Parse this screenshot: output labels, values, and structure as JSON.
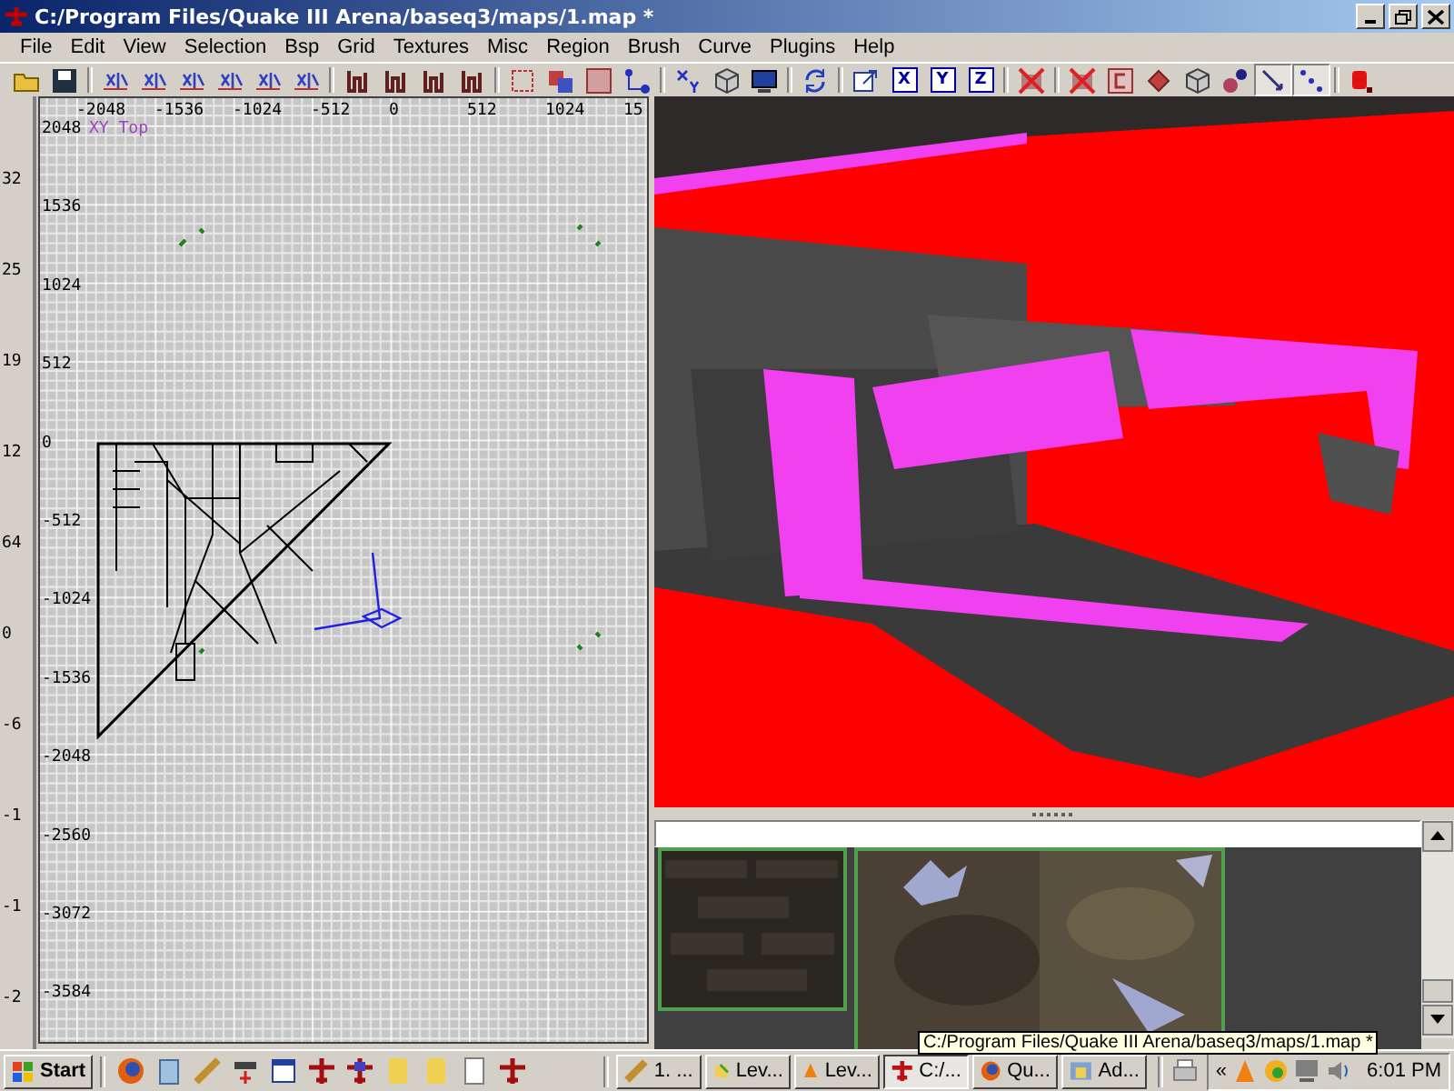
{
  "window": {
    "title": "C:/Program Files/Quake III Arena/baseq3/maps/1.map *"
  },
  "menu": [
    "File",
    "Edit",
    "View",
    "Selection",
    "Bsp",
    "Grid",
    "Textures",
    "Misc",
    "Region",
    "Brush",
    "Curve",
    "Plugins",
    "Help"
  ],
  "toolbar": [
    {
      "kind": "button",
      "selected": false
    },
    {
      "kind": "button",
      "selected": false
    },
    {
      "kind": "separator"
    },
    {
      "kind": "button",
      "selected": false
    },
    {
      "kind": "button",
      "selected": false
    },
    {
      "kind": "button",
      "selected": false
    },
    {
      "kind": "button",
      "selected": false
    },
    {
      "kind": "button",
      "selected": false
    },
    {
      "kind": "button",
      "selected": false
    },
    {
      "kind": "separator"
    },
    {
      "kind": "button",
      "selected": false
    },
    {
      "kind": "button",
      "selected": false
    },
    {
      "kind": "button",
      "selected": false
    },
    {
      "kind": "button",
      "selected": false
    },
    {
      "kind": "separator"
    },
    {
      "kind": "button",
      "selected": false
    },
    {
      "kind": "button",
      "selected": false
    },
    {
      "kind": "button",
      "selected": false
    },
    {
      "kind": "button",
      "selected": false
    },
    {
      "kind": "separator"
    },
    {
      "kind": "button",
      "selected": false
    },
    {
      "kind": "button",
      "selected": false
    },
    {
      "kind": "button",
      "selected": false
    },
    {
      "kind": "separator"
    },
    {
      "kind": "button",
      "selected": false
    },
    {
      "kind": "separator"
    },
    {
      "kind": "button",
      "selected": false
    },
    {
      "kind": "button",
      "selected": false,
      "label": "X"
    },
    {
      "kind": "button",
      "selected": false,
      "label": "Y"
    },
    {
      "kind": "button",
      "selected": false,
      "label": "Z"
    },
    {
      "kind": "separator"
    },
    {
      "kind": "button",
      "selected": false
    },
    {
      "kind": "separator"
    },
    {
      "kind": "button",
      "selected": false
    },
    {
      "kind": "button",
      "selected": false
    },
    {
      "kind": "button",
      "selected": false
    },
    {
      "kind": "button",
      "selected": false
    },
    {
      "kind": "button",
      "selected": false
    },
    {
      "kind": "button",
      "selected": true
    },
    {
      "kind": "button",
      "selected": true
    },
    {
      "kind": "separator"
    },
    {
      "kind": "button",
      "selected": false
    }
  ],
  "z_view": {
    "labels": [
      "32",
      "25",
      "19",
      "12",
      "64",
      "0",
      "-6",
      "-1",
      "-1",
      "-2"
    ]
  },
  "xy_view": {
    "title": "XY Top",
    "x_labels": [
      "-2048",
      "-1536",
      "-1024",
      "-512",
      "0",
      "512",
      "1024",
      "15"
    ],
    "y_labels": [
      "2048",
      "1536",
      "1024",
      "512",
      "0",
      "-512",
      "-1024",
      "-1536",
      "-2048",
      "-2560",
      "-3072",
      "-3584"
    ]
  },
  "taskbar": {
    "start": "Start",
    "tasks": [
      {
        "label": "1. ...",
        "selected": false
      },
      {
        "label": "Lev...",
        "selected": false
      },
      {
        "label": "Lev...",
        "selected": false
      },
      {
        "label": "C:/...",
        "selected": true
      },
      {
        "label": "Qu...",
        "selected": false
      },
      {
        "label": "Ad...",
        "selected": false
      }
    ],
    "tray_expand": "«",
    "clock": "6:01 PM"
  },
  "tooltip": "C:/Program Files/Quake III Arena/baseq3/maps/1.map *"
}
